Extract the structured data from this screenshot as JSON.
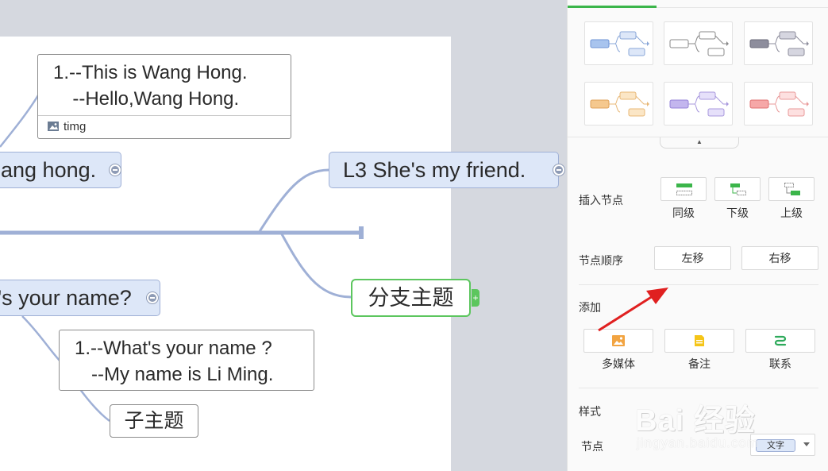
{
  "canvas": {
    "left_topic": "ang hong.",
    "name_topic": "'s your name?",
    "right_topic": "L3  She's my friend.",
    "branch_topic": "分支主题",
    "subtopic": "子主题",
    "note_top": {
      "line1": "1.--This is Wang Hong.",
      "line2": "  --Hello,Wang Hong.",
      "attachment": "timg"
    },
    "note_bottom": {
      "line1": "1.--What's your name ?",
      "line2": "   --My name is Li Ming."
    },
    "add_handle": "+"
  },
  "panel": {
    "theme_collapse": "▲",
    "insert_node": {
      "label": "插入节点",
      "same_level": "同级",
      "child_level": "下级",
      "parent_level": "上级"
    },
    "node_order": {
      "label": "节点顺序",
      "move_left": "左移",
      "move_right": "右移"
    },
    "add": {
      "label": "添加",
      "media": "多媒体",
      "note": "备注",
      "link": "联系"
    },
    "style": {
      "label": "样式",
      "node_label": "节点",
      "node_value": "文字"
    }
  },
  "watermark": {
    "brand": "Bai 经验",
    "site": "jingyan.baidu.com"
  },
  "colors": {
    "accent": "#3bb54a",
    "topic_fill": "#dde7f8",
    "topic_border": "#9fb0d6",
    "connector": "#9fb0d6",
    "arrow": "#e02020"
  },
  "themes": [
    {
      "main": "#a8c4ee",
      "main_border": "#6f95d6",
      "sub": "#dde7f8",
      "sub_border": "#8aa7d8"
    },
    {
      "main": "#ffffff",
      "main_border": "#888888",
      "sub": "#ffffff",
      "sub_border": "#888888"
    },
    {
      "main": "#8d8d9c",
      "main_border": "#6b6b7a",
      "sub": "#d6d6e0",
      "sub_border": "#8d8d9c"
    },
    {
      "main": "#f5c88e",
      "main_border": "#e0a25a",
      "sub": "#fbe6c6",
      "sub_border": "#e8b877"
    },
    {
      "main": "#c3b6ee",
      "main_border": "#9683d8",
      "sub": "#e6e0fa",
      "sub_border": "#a898dd"
    },
    {
      "main": "#f6a7a7",
      "main_border": "#e07272",
      "sub": "#fde0e0",
      "sub_border": "#e99a9a"
    }
  ]
}
